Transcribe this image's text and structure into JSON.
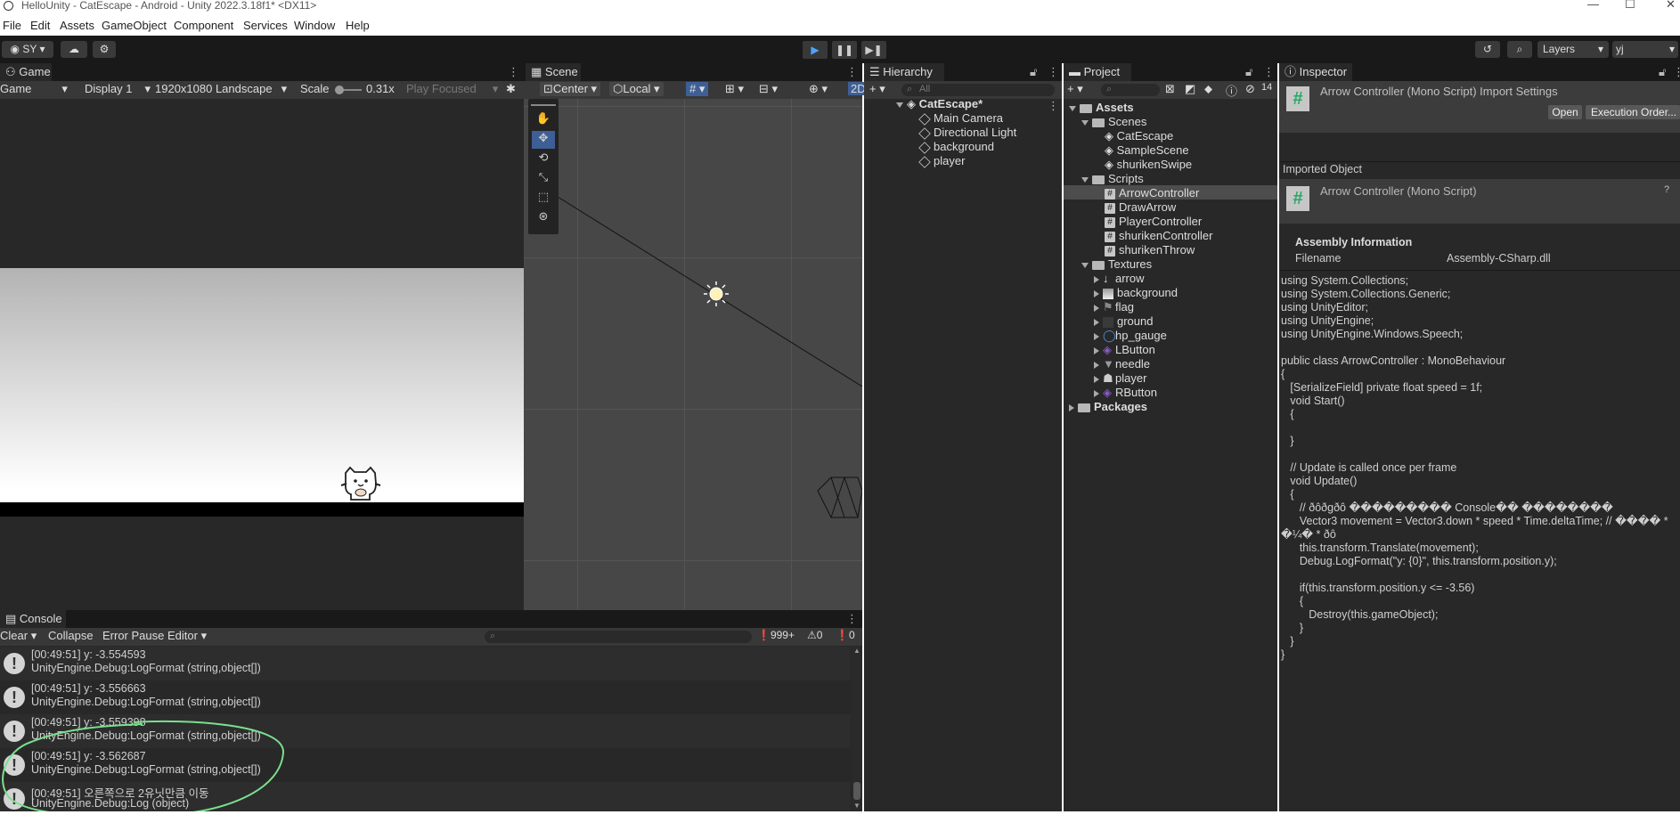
{
  "window": {
    "title": "HelloUnity - CatEscape - Android - Unity 2022.3.18f1* <DX11>"
  },
  "menu": [
    "File",
    "Edit",
    "Assets",
    "GameObject",
    "Component",
    "Services",
    "Window",
    "Help"
  ],
  "toolbar": {
    "account": "SY",
    "layers_label": "Layers",
    "layout_label": "yj"
  },
  "game": {
    "tab": "Game",
    "mode": "Game",
    "display": "Display 1",
    "resolution": "1920x1080 Landscape",
    "scale_label": "Scale",
    "scale_value": "0.31x",
    "play_focused": "Play Focused"
  },
  "scene": {
    "tab": "Scene",
    "pivot": "Center",
    "space": "Local",
    "mode_2d": "2D"
  },
  "hierarchy": {
    "tab": "Hierarchy",
    "search_placeholder": "All",
    "scene_name": "CatEscape*",
    "items": [
      "Main Camera",
      "Directional Light",
      "background",
      "player"
    ]
  },
  "project": {
    "tab": "Project",
    "visible_count": "14",
    "assets_label": "Assets",
    "scenes_label": "Scenes",
    "scenes": [
      "CatEscape",
      "SampleScene",
      "shurikenSwipe"
    ],
    "scripts_label": "Scripts",
    "scripts": [
      "ArrowController",
      "DrawArrow",
      "PlayerController",
      "shurikenController",
      "shurikenThrow"
    ],
    "textures_label": "Textures",
    "textures": [
      "arrow",
      "background",
      "flag",
      "ground",
      "hp_gauge",
      "LButton",
      "needle",
      "player",
      "RButton"
    ],
    "packages_label": "Packages"
  },
  "inspector": {
    "tab": "Inspector",
    "title": "Arrow Controller (Mono Script) Import Settings",
    "open_button": "Open",
    "exec_order_button": "Execution Order...",
    "imported_object_label": "Imported Object",
    "object_name": "Arrow Controller (Mono Script)",
    "assembly_info_label": "Assembly Information",
    "filename_label": "Filename",
    "filename_value": "Assembly-CSharp.dll",
    "code": [
      "using System.Collections;",
      "using System.Collections.Generic;",
      "using UnityEditor;",
      "using UnityEngine;",
      "using UnityEngine.Windows.Speech;",
      "",
      "public class ArrowController : MonoBehaviour",
      "{",
      "   [SerializeField] private float speed = 1f;",
      "   void Start()",
      "   {",
      "",
      "   }",
      "",
      "   // Update is called once per frame",
      "   void Update()",
      "   {",
      "      // ðôðgðô ��������� Console�� ��������",
      "      Vector3 movement = Vector3.down * speed * Time.deltaTime; // ���� * ",
      "�¼� * ðô",
      "      this.transform.Translate(movement);",
      "      Debug.LogFormat(\"y: {0}\", this.transform.position.y);",
      "",
      "      if(this.transform.position.y <= -3.56)",
      "      {",
      "         Destroy(this.gameObject);",
      "      }",
      "   }",
      "}"
    ]
  },
  "console": {
    "tab": "Console",
    "clear": "Clear",
    "collapse": "Collapse",
    "error_pause": "Error Pause",
    "editor": "Editor",
    "log_count": "999+",
    "warn_count": "0",
    "error_count": "0",
    "entries": [
      {
        "line1": "[00:49:51] y: -3.554593",
        "line2": "UnityEngine.Debug:LogFormat (string,object[])"
      },
      {
        "line1": "[00:49:51] y: -3.556663",
        "line2": "UnityEngine.Debug:LogFormat (string,object[])"
      },
      {
        "line1": "[00:49:51] y: -3.559398",
        "line2": "UnityEngine.Debug:LogFormat (string,object[])"
      },
      {
        "line1": "[00:49:51] y: -3.562687",
        "line2": "UnityEngine.Debug:LogFormat (string,object[])"
      },
      {
        "line1": "[00:49:51] 오른쪽으로 2유닛만큼 이동",
        "line2": "UnityEngine.Debug:Log (object)"
      }
    ]
  },
  "colors": {
    "editor_bg": "#282828",
    "toolbar_bg": "#191919",
    "selected_row": "#3e5f96",
    "annotation": "#7ae08f"
  }
}
